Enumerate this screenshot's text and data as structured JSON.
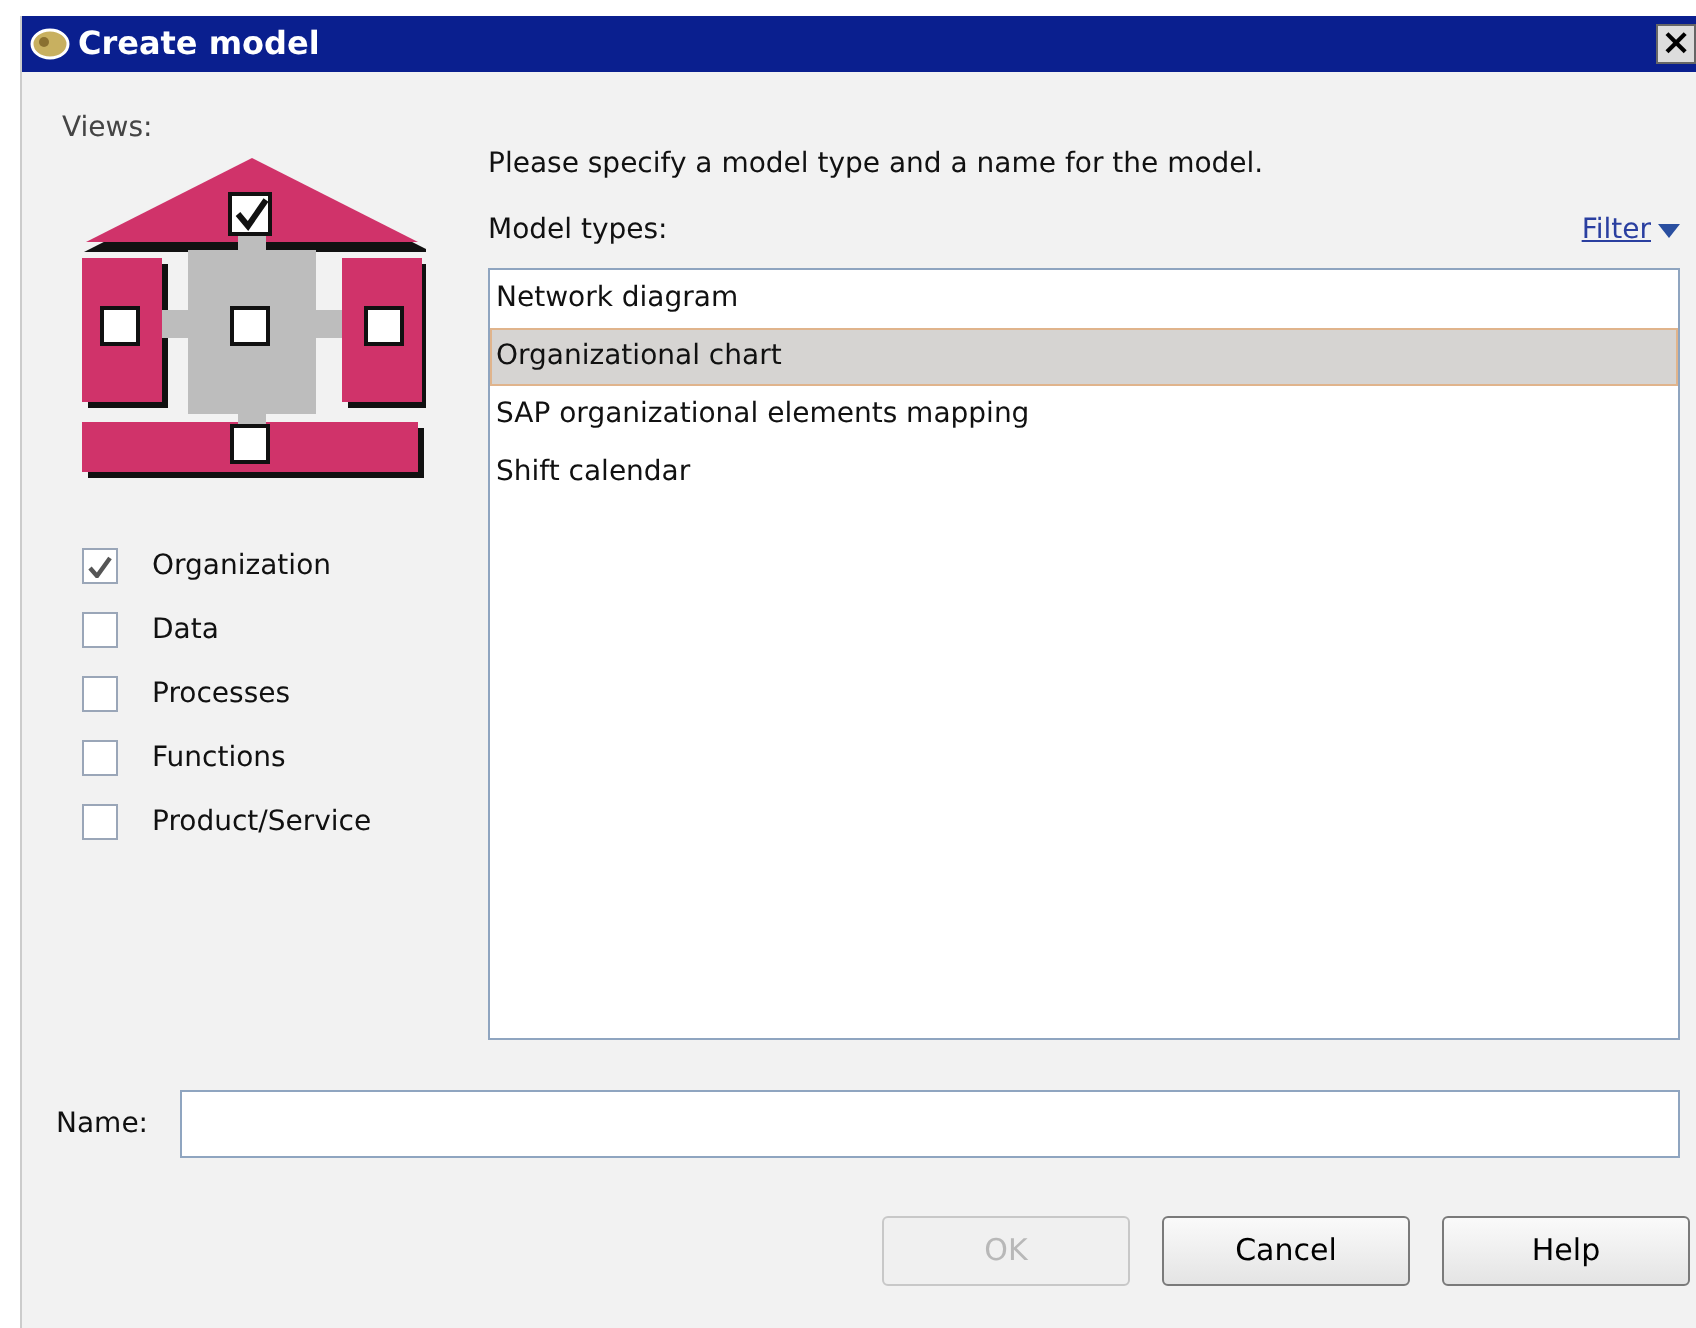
{
  "window": {
    "title": "Create model",
    "close": "×"
  },
  "views_label": "Views:",
  "views": [
    {
      "label": "Organization",
      "checked": true
    },
    {
      "label": "Data",
      "checked": false
    },
    {
      "label": "Processes",
      "checked": false
    },
    {
      "label": "Functions",
      "checked": false
    },
    {
      "label": "Product/Service",
      "checked": false
    }
  ],
  "instruction": "Please specify a model type and a name for the model.",
  "model_types_label": "Model types:",
  "filter": "Filter",
  "model_types": [
    {
      "label": "Network diagram",
      "selected": false
    },
    {
      "label": "Organizational chart",
      "selected": true
    },
    {
      "label": "SAP organizational elements mapping",
      "selected": false
    },
    {
      "label": "Shift calendar",
      "selected": false
    }
  ],
  "name_label": "Name:",
  "buttons": [
    {
      "label": "OK",
      "disabled": true
    },
    {
      "label": "Cancel",
      "disabled": false
    },
    {
      "label": "Help",
      "disabled": false
    }
  ]
}
